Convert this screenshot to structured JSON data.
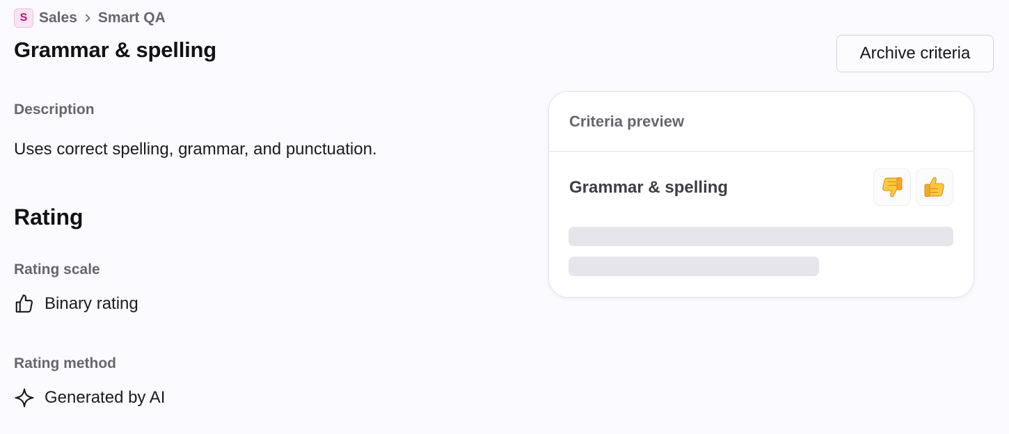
{
  "breadcrumb": {
    "workspace_initial": "S",
    "workspace": "Sales",
    "current": "Smart QA"
  },
  "page": {
    "title": "Grammar & spelling",
    "archive_label": "Archive criteria"
  },
  "description": {
    "label": "Description",
    "text": "Uses correct spelling, grammar, and punctuation."
  },
  "rating": {
    "heading": "Rating",
    "scale_label": "Rating scale",
    "scale_value": "Binary rating",
    "scale_icon": "thumbs-up-icon",
    "method_label": "Rating method",
    "method_value": "Generated by AI",
    "method_icon": "sparkle-icon"
  },
  "preview": {
    "header": "Criteria preview",
    "title": "Grammar & spelling",
    "down_icon": "thumbs-down-emoji",
    "up_icon": "thumbs-up-emoji"
  },
  "colors": {
    "background": "#fafaff",
    "badge_bg": "#fbe3f2",
    "badge_text": "#b0157a",
    "skeleton": "#e7e5ec"
  }
}
